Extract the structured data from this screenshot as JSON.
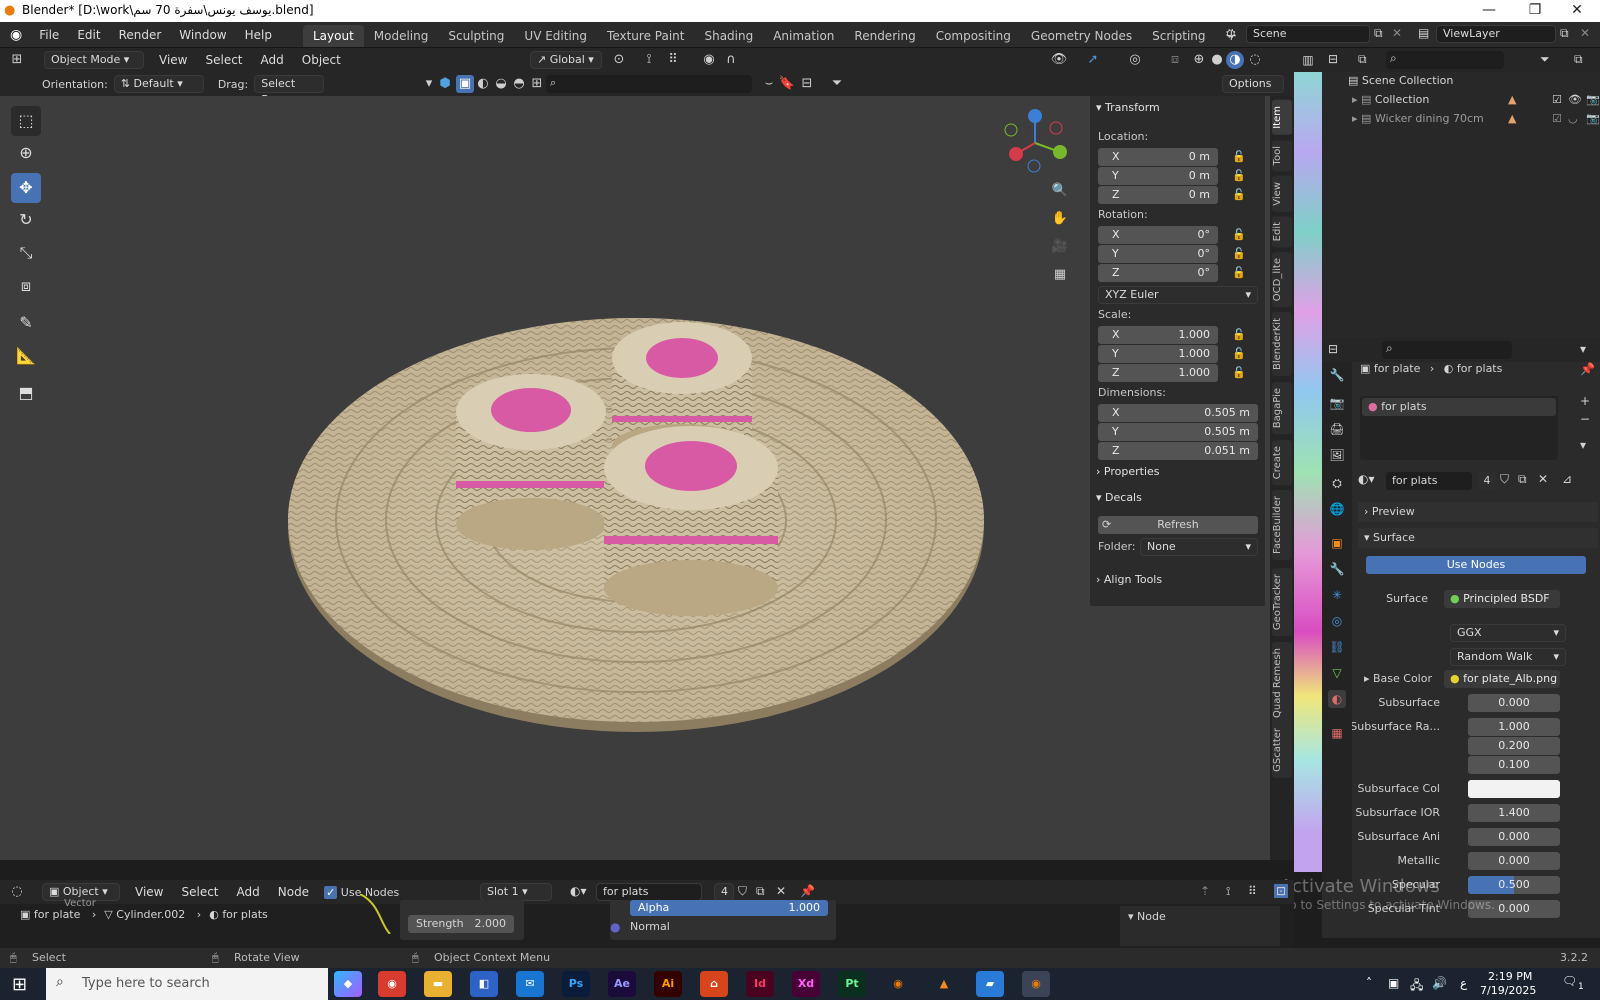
{
  "window": {
    "title": "Blender* [D:\\work\\يوسف يونس\\سفرة 70 سم.blend]"
  },
  "menu": {
    "items": [
      "File",
      "Edit",
      "Render",
      "Window",
      "Help"
    ]
  },
  "workspaces": [
    "Layout",
    "Modeling",
    "Sculpting",
    "UV Editing",
    "Texture Paint",
    "Shading",
    "Animation",
    "Rendering",
    "Compositing",
    "Geometry Nodes",
    "Scripting"
  ],
  "scene": {
    "name": "Scene",
    "view_layer": "ViewLayer"
  },
  "viewport_header": {
    "mode": "Object Mode",
    "menus": [
      "View",
      "Select",
      "Add",
      "Object"
    ],
    "transform_orientation": "Global",
    "orientation_label": "Orientation:",
    "orientation_value": "Default",
    "drag_label": "Drag:",
    "drag_value": "Select Box",
    "options": "Options"
  },
  "npanel": {
    "transform_title": "Transform",
    "location_label": "Location:",
    "location": [
      {
        "axis": "X",
        "value": "0 m"
      },
      {
        "axis": "Y",
        "value": "0 m"
      },
      {
        "axis": "Z",
        "value": "0 m"
      }
    ],
    "rotation_label": "Rotation:",
    "rotation": [
      {
        "axis": "X",
        "value": "0°"
      },
      {
        "axis": "Y",
        "value": "0°"
      },
      {
        "axis": "Z",
        "value": "0°"
      }
    ],
    "rotation_mode": "XYZ Euler",
    "scale_label": "Scale:",
    "scale": [
      {
        "axis": "X",
        "value": "1.000"
      },
      {
        "axis": "Y",
        "value": "1.000"
      },
      {
        "axis": "Z",
        "value": "1.000"
      }
    ],
    "dimensions_label": "Dimensions:",
    "dimensions": [
      {
        "axis": "X",
        "value": "0.505 m"
      },
      {
        "axis": "Y",
        "value": "0.505 m"
      },
      {
        "axis": "Z",
        "value": "0.051 m"
      }
    ],
    "properties": "Properties",
    "decals": "Decals",
    "refresh": "Refresh",
    "folder_label": "Folder:",
    "folder_value": "None",
    "align_tools": "Align Tools"
  },
  "side_tabs": [
    "Item",
    "Tool",
    "View",
    "Edit",
    "OCD_lite",
    "BlenderKit",
    "BagaPie",
    "Create",
    "FaceBuilder",
    "GeoTracker",
    "Quad Remesh",
    "GScatter"
  ],
  "outliner": {
    "root": "Scene Collection",
    "items": [
      {
        "name": "Collection"
      },
      {
        "name": "Wicker dining 70cm"
      }
    ]
  },
  "properties": {
    "breadcrumb_object": "for plate",
    "breadcrumb_material": "for plats",
    "slot_name": "for plats",
    "material_name": "for plats",
    "material_users": "4",
    "preview": "Preview",
    "surface_section": "Surface",
    "use_nodes": "Use Nodes",
    "surface_label": "Surface",
    "surface_value": "Principled BSDF",
    "distribution": "GGX",
    "subsurface_method": "Random Walk",
    "rows": [
      {
        "label": "Base Color",
        "value": "for plate_Alb.png"
      },
      {
        "label": "Subsurface",
        "value": "0.000"
      },
      {
        "label": "Subsurface Ra...",
        "value": "1.000"
      },
      {
        "label": "",
        "value": "0.200"
      },
      {
        "label": "",
        "value": "0.100"
      },
      {
        "label": "Subsurface Col",
        "value": ""
      },
      {
        "label": "Subsurface IOR",
        "value": "1.400"
      },
      {
        "label": "Subsurface Ani",
        "value": "0.000"
      },
      {
        "label": "Metallic",
        "value": "0.000"
      },
      {
        "label": "Specular",
        "value": "0.500"
      },
      {
        "label": "Specular Tint",
        "value": "0.000"
      }
    ]
  },
  "node_editor": {
    "type": "Object",
    "menus": [
      "View",
      "Select",
      "Add",
      "Node"
    ],
    "use_nodes": "Use Nodes",
    "slot": "Slot 1",
    "material": "for plats",
    "users": "4",
    "breadcrumb": [
      "for plate",
      "Cylinder.002",
      "for plats"
    ],
    "strength_label": "Strength",
    "strength_value": "2.000",
    "alpha_label": "Alpha",
    "alpha_value": "1.000",
    "normal_label": "Normal",
    "vector_label": "Vector",
    "node_panel": "Node"
  },
  "watermark": {
    "line1": "Activate Windows",
    "line2": "Go to Settings to activate Windows."
  },
  "statusbar": {
    "select": "Select",
    "rotate": "Rotate View",
    "context": "Object Context Menu",
    "version": "3.2.2"
  },
  "taskbar": {
    "search_placeholder": "Type here to search",
    "apps": [
      "Ps",
      "Ae",
      "Ai",
      "Id",
      "Xd",
      "Pt"
    ],
    "time": "2:19 PM",
    "date": "7/19/2025",
    "lang": "ع",
    "notifications": "1"
  }
}
